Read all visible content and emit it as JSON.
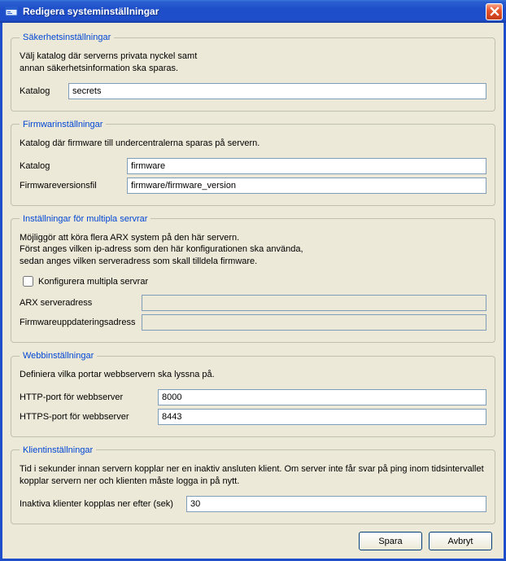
{
  "window": {
    "title": "Redigera systeminställningar"
  },
  "security": {
    "legend": "Säkerhetsinställningar",
    "desc1": "Välj katalog där serverns privata nyckel samt",
    "desc2": "annan säkerhetsinformation ska sparas.",
    "katalog_label": "Katalog",
    "katalog_value": "secrets"
  },
  "firmware": {
    "legend": "Firmwarinställningar",
    "desc": "Katalog där firmware till undercentralerna sparas på servern.",
    "katalog_label": "Katalog",
    "katalog_value": "firmware",
    "version_label": "Firmwareversionsfil",
    "version_value": "firmware/firmware_version"
  },
  "multi": {
    "legend": "Inställningar för multipla servrar",
    "desc1": "Möjliggör att köra flera ARX system på den här servern.",
    "desc2": "Först anges vilken ip-adress som den här konfigurationen ska använda,",
    "desc3": "sedan anges vilken serveradress som skall tilldela firmware.",
    "checkbox_label": "Konfigurera multipla servrar",
    "arx_label": "ARX serveradress",
    "arx_value": "",
    "fw_label": "Firmwareuppdateringsadress",
    "fw_value": ""
  },
  "web": {
    "legend": "Webbinställningar",
    "desc": "Definiera vilka portar webbservern ska lyssna på.",
    "http_label": "HTTP-port för webbserver",
    "http_value": "8000",
    "https_label": "HTTPS-port för webbserver",
    "https_value": "8443"
  },
  "client": {
    "legend": "Klientinställningar",
    "desc": "Tid i sekunder innan servern kopplar ner en inaktiv ansluten klient. Om server inte får svar på ping inom tidsintervallet kopplar servern ner och klienten måste logga in på nytt.",
    "timeout_label": "Inaktiva klienter kopplas ner efter (sek)",
    "timeout_value": "30"
  },
  "buttons": {
    "save": "Spara",
    "cancel": "Avbryt"
  }
}
